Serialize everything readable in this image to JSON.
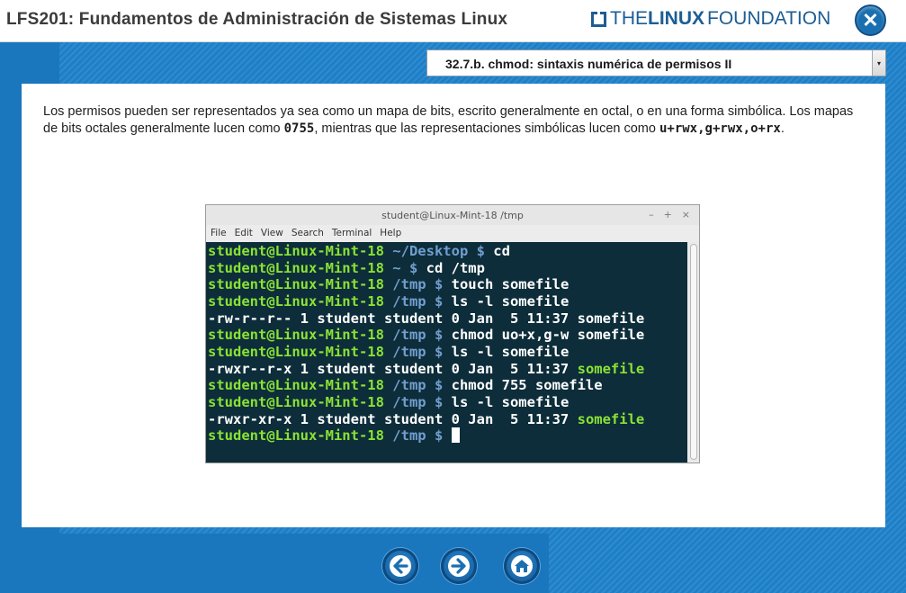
{
  "header": {
    "course_title": "LFS201: Fundamentos de Administración de Sistemas Linux",
    "logo_the": "THE",
    "logo_linux": "LINUX",
    "logo_foundation": "FOUNDATION",
    "close_symbol": "✕"
  },
  "nav_select": {
    "selected": "32.7.b. chmod: sintaxis numérica de permisos II",
    "arrow": "▾"
  },
  "content": {
    "para_1": "Los permisos pueden ser representados ya sea como un mapa de bits, escrito generalmente en octal, o en una forma simbólica. Los mapas de bits octales generalmente lucen como ",
    "para_code_1": "0755",
    "para_2": ", mientras que las representaciones simbólicas lucen como ",
    "para_code_2": "u+rwx,g+rwx,o+rx",
    "para_3": "."
  },
  "terminal": {
    "title": "student@Linux-Mint-18 /tmp",
    "win_minimize": "–",
    "win_maximize": "+",
    "win_close": "×",
    "menu": [
      "File",
      "Edit",
      "View",
      "Search",
      "Terminal",
      "Help"
    ],
    "lines": [
      {
        "prompt": "student@Linux-Mint-18",
        "path": " ~/Desktop $",
        "cmd": " cd"
      },
      {
        "prompt": "student@Linux-Mint-18",
        "path": " ~ $",
        "cmd": " cd /tmp"
      },
      {
        "prompt": "student@Linux-Mint-18",
        "path": " /tmp $",
        "cmd": " touch somefile"
      },
      {
        "prompt": "student@Linux-Mint-18",
        "path": " /tmp $",
        "cmd": " ls -l somefile"
      },
      {
        "output": "-rw-r--r-- 1 student student 0 Jan  5 11:37 somefile"
      },
      {
        "prompt": "student@Linux-Mint-18",
        "path": " /tmp $",
        "cmd": " chmod uo+x,g-w somefile"
      },
      {
        "prompt": "student@Linux-Mint-18",
        "path": " /tmp $",
        "cmd": " ls -l somefile"
      },
      {
        "output": "-rwxr--r-x 1 student student 0 Jan  5 11:37 ",
        "file": "somefile"
      },
      {
        "prompt": "student@Linux-Mint-18",
        "path": " /tmp $",
        "cmd": " chmod 755 somefile"
      },
      {
        "prompt": "student@Linux-Mint-18",
        "path": " /tmp $",
        "cmd": " ls -l somefile"
      },
      {
        "output": "-rwxr-xr-x 1 student student 0 Jan  5 11:37 ",
        "file": "somefile"
      },
      {
        "prompt": "student@Linux-Mint-18",
        "path": " /tmp $",
        "cmd": " "
      }
    ]
  },
  "bottom_nav": {
    "back": "back-arrow-icon",
    "forward": "forward-arrow-icon",
    "home": "home-icon"
  },
  "colors": {
    "prompt_green": "#8ae234",
    "path_blue": "#729fcf",
    "terminal_bg": "#0d2d3a",
    "brand_blue": "#1c5d94"
  }
}
